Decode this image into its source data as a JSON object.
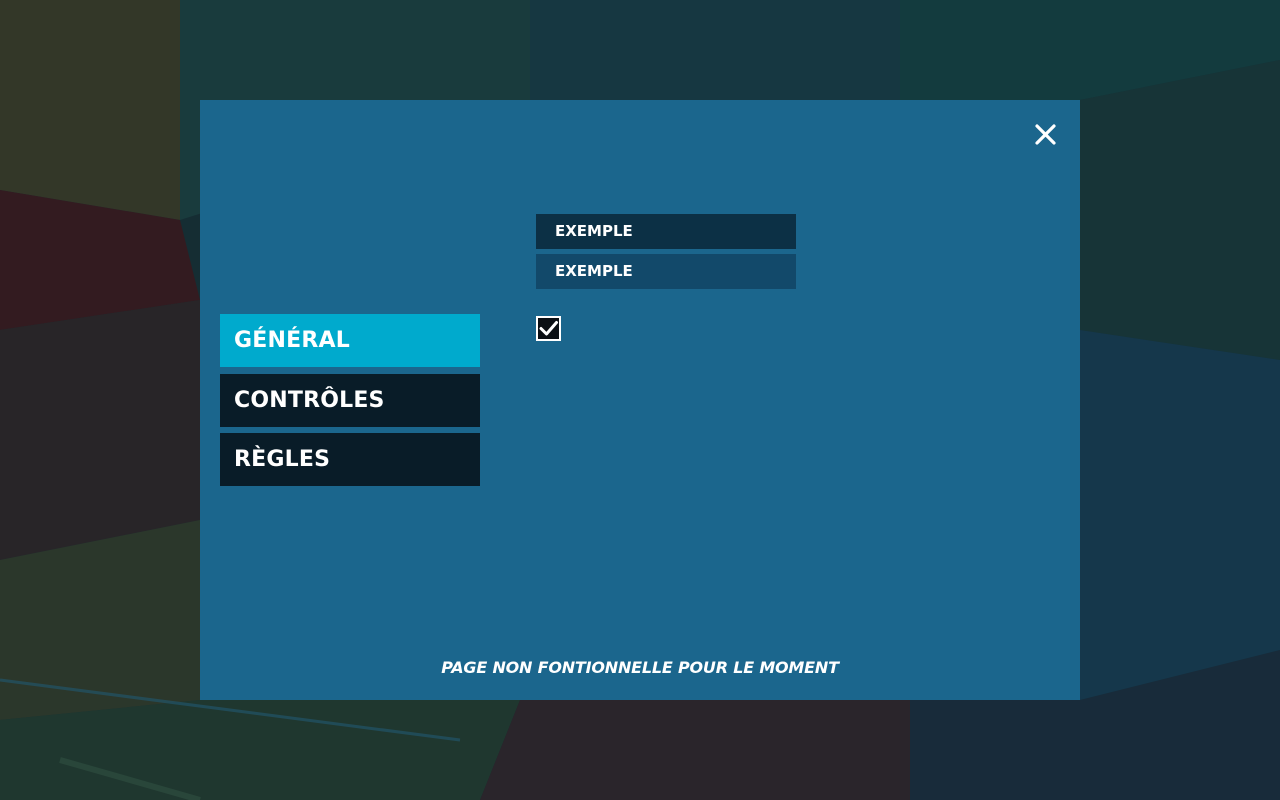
{
  "settings_modal": {
    "close_icon": "close-icon",
    "menu": [
      {
        "label": "Général",
        "active": true
      },
      {
        "label": "Contrôles",
        "active": false
      },
      {
        "label": "Règles",
        "active": false
      }
    ],
    "fields": [
      {
        "value": "Exemple"
      },
      {
        "value": "Exemple"
      }
    ],
    "checkbox": {
      "checked": true,
      "icon": "checkmark-icon"
    },
    "footer_note": "Page non fontionnelle pour le moment"
  },
  "colors": {
    "panel": "#1b668d",
    "menu_active": "#00aacd",
    "menu_inactive": "#091c28",
    "field_dark": "#0c3045",
    "field_light": "#12496a"
  }
}
